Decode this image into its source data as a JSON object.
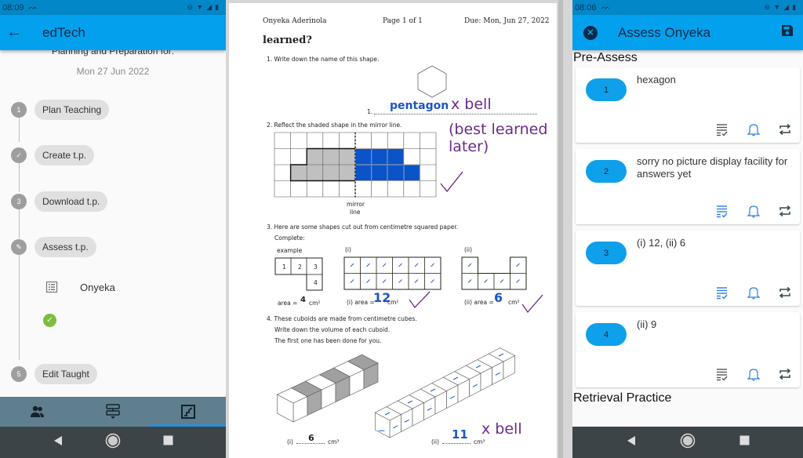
{
  "left_phone": {
    "status_time": "08:09",
    "app_title": "edTech",
    "subtitle": "Planning and Preparation for:",
    "date": "Mon 27 Jun 2022",
    "steps": [
      {
        "marker": "1",
        "label": "Plan Teaching"
      },
      {
        "marker": "check",
        "label": "Create t.p."
      },
      {
        "marker": "3",
        "label": "Download t.p."
      },
      {
        "marker": "edit",
        "label": "Assess t.p."
      },
      {
        "marker": "5",
        "label": "Edit Taught"
      }
    ],
    "student": "Onyeka",
    "bottom_nav": [
      "people-icon",
      "flow-icon",
      "stairs-icon"
    ]
  },
  "document": {
    "student_name": "Onyeka Aderinola",
    "page": "Page 1 of 1",
    "due": "Due: Mon, Jun 27, 2022",
    "heading": "learned?",
    "q1": {
      "text": "1.  Write down the name of this shape.",
      "answer_label": "1.",
      "answer": "pentagon",
      "mark": "x bell",
      "comment": "(best learned later)"
    },
    "q2": {
      "text": "2.  Reflect the shaded shape in the mirror line.",
      "mirror_label_1": "mirror",
      "mirror_label_2": "line"
    },
    "q3": {
      "text": "3.  Here are some shapes cut out from centimetre squared paper.",
      "sub": "Complete:",
      "example_label": "example",
      "example_cells": [
        "1",
        "2",
        "3",
        "4"
      ],
      "example_area_prefix": "area = ",
      "example_area": "4",
      "unit": "cm²",
      "i_label": "(i)",
      "i_area_prefix": "(i) area = ",
      "i_answer": "12",
      "ii_label": "(ii)",
      "ii_area_prefix": "(ii) area = ",
      "ii_answer": "6"
    },
    "q4": {
      "line1": "4.  These cuboids are made from centimetre cubes.",
      "line2": "Write down the volume of each cuboid.",
      "line3": "The first one has been done for you.",
      "i_label": "(i)",
      "i_answer": "6",
      "ii_label": "(ii)",
      "ii_answer": "11",
      "unit": "cm³",
      "mark": "x bell"
    }
  },
  "right_phone": {
    "status_time": "08:06",
    "app_title": "Assess Onyeka",
    "section_1": "Pre-Assess",
    "answers": [
      {
        "num": "1",
        "text": "hexagon"
      },
      {
        "num": "2",
        "text": "sorry no picture display facility for answers yet"
      },
      {
        "num": "3",
        "text": "(i) 12, (ii) 6"
      },
      {
        "num": "4",
        "text": "(ii) 9"
      }
    ],
    "section_2": "Retrieval Practice"
  },
  "colors": {
    "appbar": "#03a0ee",
    "statusbar": "#0288c9",
    "answer_pill": "#0ea0ea",
    "bottom_nav": "#5f7f8f",
    "handwriting_blue": "#1d55c6",
    "handwriting_purple": "#6a2a8a",
    "fill_blue": "#0b53c9",
    "check_green": "#7cbd3e"
  }
}
